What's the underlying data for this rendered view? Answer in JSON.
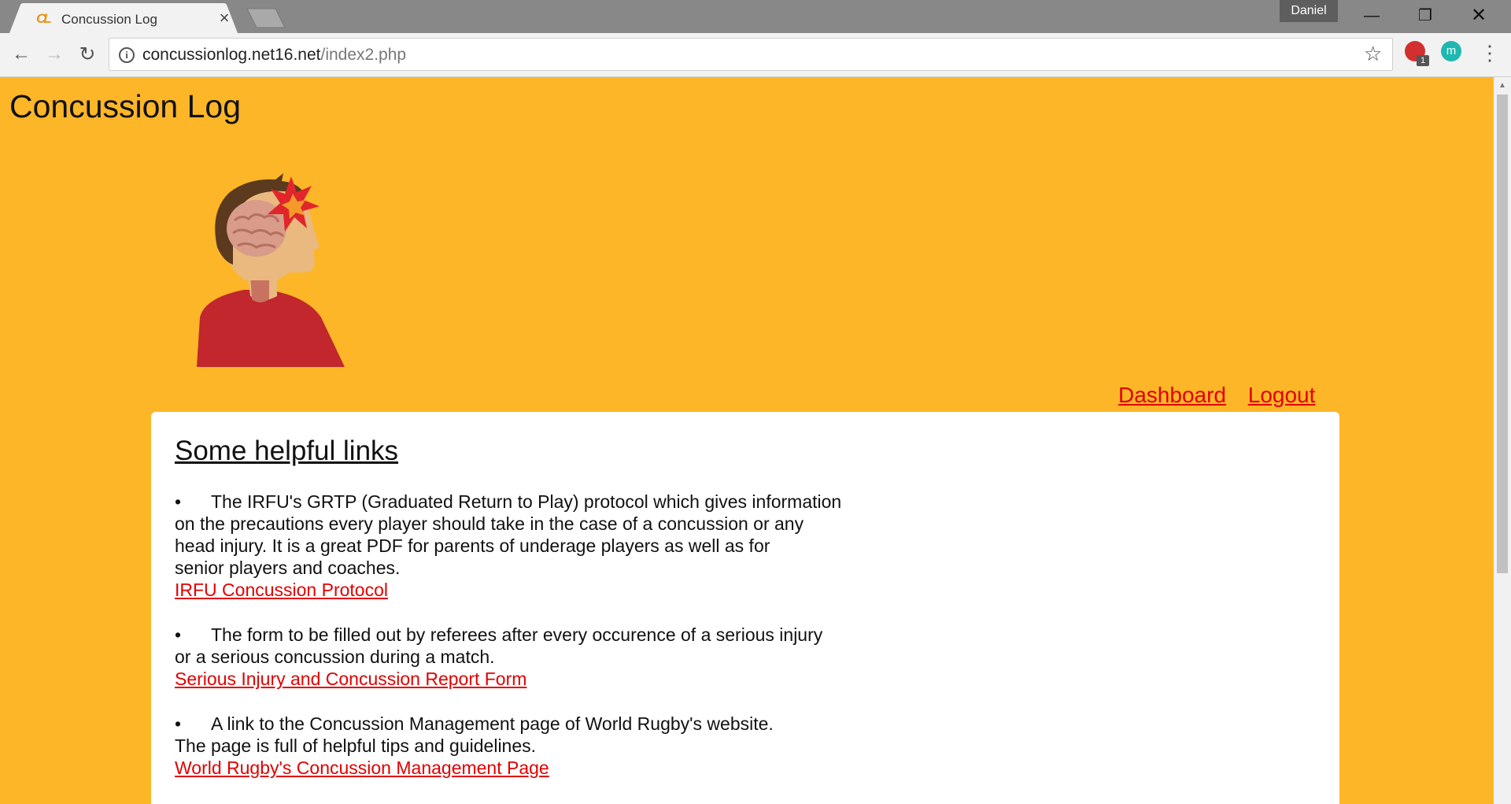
{
  "browser": {
    "tab": {
      "favicon_text": "CL",
      "title": "Concussion Log",
      "close": "×"
    },
    "profile_name": "Daniel",
    "window_controls": {
      "minimize": "—",
      "restore": "❐",
      "close": "✕"
    },
    "nav": {
      "back": "←",
      "forward": "→",
      "reload": "↻"
    },
    "url": {
      "host": "concussionlog.net16.net",
      "path": "/index2.php"
    },
    "bookmark_star": "☆",
    "extensions": [
      {
        "name": "adblock-extension",
        "badge": "1"
      },
      {
        "name": "m-extension",
        "glyph": "m"
      }
    ],
    "menu": "⋮"
  },
  "page": {
    "site_title": "Concussion Log",
    "nav_links": {
      "dashboard": "Dashboard",
      "logout": "Logout"
    },
    "card": {
      "heading": "Some helpful links",
      "items": [
        {
          "bullet": "•",
          "desc_lines": [
            "The IRFU's GRTP (Graduated Return to Play) protocol which gives information",
            "on the precautions every player should take in the case of a concussion or any",
            "head injury. It is a great PDF for parents of underage players as well as for",
            "senior players and coaches."
          ],
          "link": "IRFU Concussion Protocol"
        },
        {
          "bullet": "•",
          "desc_lines": [
            "The form to be filled out by referees after every occurence of a serious injury",
            "or a serious concussion during a match."
          ],
          "link": "Serious Injury and Concussion Report Form"
        },
        {
          "bullet": "•",
          "desc_lines": [
            "A link to the Concussion Management page of World Rugby's website.",
            "The page is full of helpful tips and guidelines."
          ],
          "link": "World Rugby's Concussion Management Page"
        }
      ]
    }
  },
  "colors": {
    "page_background": "#fdb627",
    "link": "#e20000",
    "card_background": "#ffffff",
    "chrome": "#888888"
  }
}
